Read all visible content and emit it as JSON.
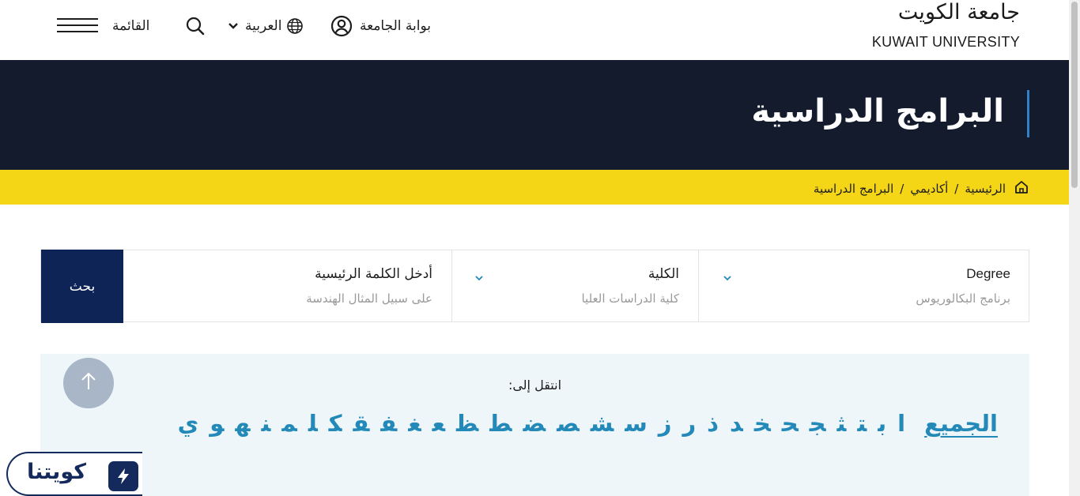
{
  "header": {
    "logo_ar": "جامعة الكويت",
    "logo_en": "KUWAIT UNIVERSITY",
    "portal_label": "بوابة الجامعة",
    "language_label": "العربية",
    "menu_label": "القائمة"
  },
  "hero": {
    "title": "البرامج الدراسية"
  },
  "breadcrumb": {
    "items": [
      "الرئيسية",
      "أكاديمي",
      "البرامج الدراسية"
    ],
    "separator": "/"
  },
  "filters": {
    "degree": {
      "label": "Degree",
      "value": "برنامج البكالوريوس"
    },
    "college": {
      "label": "الكلية",
      "value": "كلية الدراسات العليا"
    },
    "keyword": {
      "label": "أدخل الكلمة الرئيسية",
      "placeholder": "على سبيل المثال الهندسة"
    },
    "search_button": "بحث"
  },
  "alphabet": {
    "goto_label": "انتقل إلى:",
    "all": "الجميع",
    "letters": [
      "ا",
      "ب",
      "ت",
      "ث",
      "ج",
      "ح",
      "خ",
      "د",
      "ذ",
      "ر",
      "ز",
      "س",
      "ش",
      "ص",
      "ض",
      "ط",
      "ظ",
      "ع",
      "غ",
      "ف",
      "ق",
      "ك",
      "ل",
      "م",
      "ن",
      "ه",
      "و",
      "ي"
    ]
  },
  "badge": {
    "text": "كويتنا"
  },
  "colors": {
    "hero_bg": "#131b2c",
    "breadcrumb_bg": "#f5d617",
    "search_button_bg": "#0f2456",
    "accent_link": "#2389b8",
    "alphabet_bg": "#eef6f9"
  },
  "icons": {
    "portal": "user-circle-icon",
    "language": "globe-icon",
    "language_dropdown": "chevron-down-icon",
    "search": "search-icon",
    "menu": "hamburger-icon",
    "home": "home-icon",
    "back_to_top": "arrow-up-icon",
    "badge": "lightning-icon"
  }
}
